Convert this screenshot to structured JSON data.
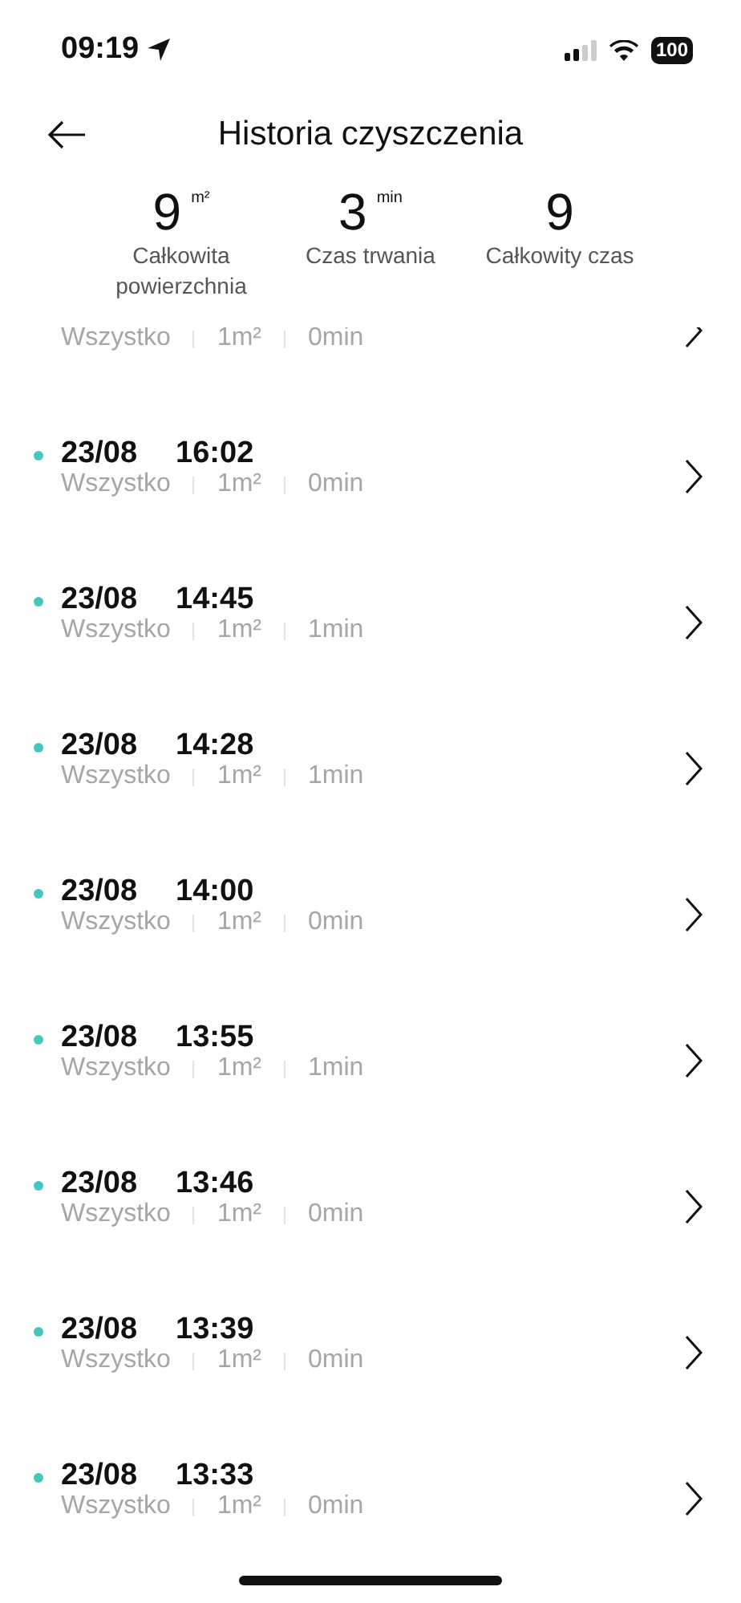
{
  "status_bar": {
    "time": "09:19",
    "battery": "100"
  },
  "header": {
    "title": "Historia czyszczenia"
  },
  "stats": [
    {
      "value": "9",
      "unit": "m²",
      "label": "Całkowita powierzchnia"
    },
    {
      "value": "3",
      "unit": "min",
      "label": "Czas trwania"
    },
    {
      "value": "9",
      "label": "Całkowity czas"
    }
  ],
  "records": [
    {
      "mode": "Wszystko",
      "area": "1m²",
      "duration": "0min"
    },
    {
      "date": "23/08",
      "time": "16:02",
      "mode": "Wszystko",
      "area": "1m²",
      "duration": "0min"
    },
    {
      "date": "23/08",
      "time": "14:45",
      "mode": "Wszystko",
      "area": "1m²",
      "duration": "1min"
    },
    {
      "date": "23/08",
      "time": "14:28",
      "mode": "Wszystko",
      "area": "1m²",
      "duration": "1min"
    },
    {
      "date": "23/08",
      "time": "14:00",
      "mode": "Wszystko",
      "area": "1m²",
      "duration": "0min"
    },
    {
      "date": "23/08",
      "time": "13:55",
      "mode": "Wszystko",
      "area": "1m²",
      "duration": "1min"
    },
    {
      "date": "23/08",
      "time": "13:46",
      "mode": "Wszystko",
      "area": "1m²",
      "duration": "0min"
    },
    {
      "date": "23/08",
      "time": "13:39",
      "mode": "Wszystko",
      "area": "1m²",
      "duration": "0min"
    },
    {
      "date": "23/08",
      "time": "13:33",
      "mode": "Wszystko",
      "area": "1m²",
      "duration": "0min"
    }
  ]
}
